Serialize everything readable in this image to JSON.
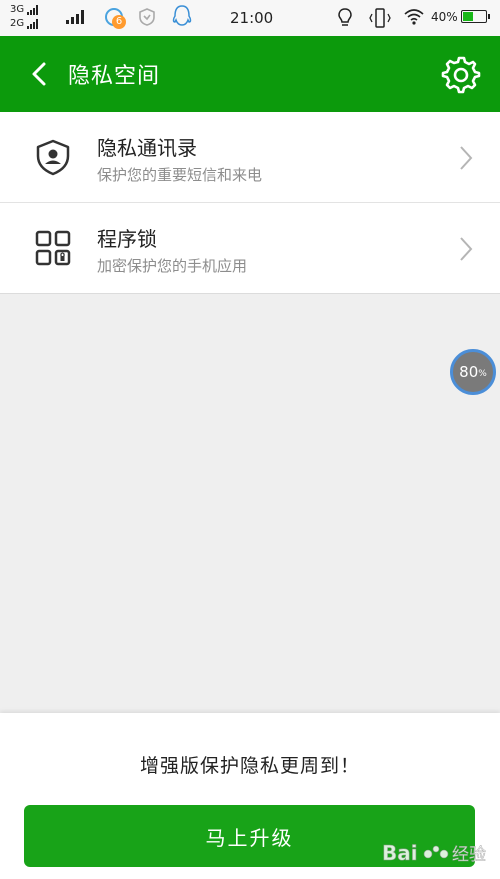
{
  "status_bar": {
    "net1": "3G",
    "net2": "2G",
    "notification_count": "6",
    "time": "21:00",
    "battery_pct": "40%",
    "battery_level": 0.4
  },
  "header": {
    "title": "隐私空间"
  },
  "items": [
    {
      "title": "隐私通讯录",
      "subtitle": "保护您的重要短信和来电"
    },
    {
      "title": "程序锁",
      "subtitle": "加密保护您的手机应用"
    }
  ],
  "progress": {
    "value": "80",
    "unit": "%"
  },
  "bottom": {
    "promo": "增强版保护隐私更周到！",
    "upgrade_label": "马上升级"
  },
  "watermark": {
    "text": "Bai经验"
  },
  "colors": {
    "brand_green": "#0c9a0c",
    "button_green": "#18a318"
  }
}
